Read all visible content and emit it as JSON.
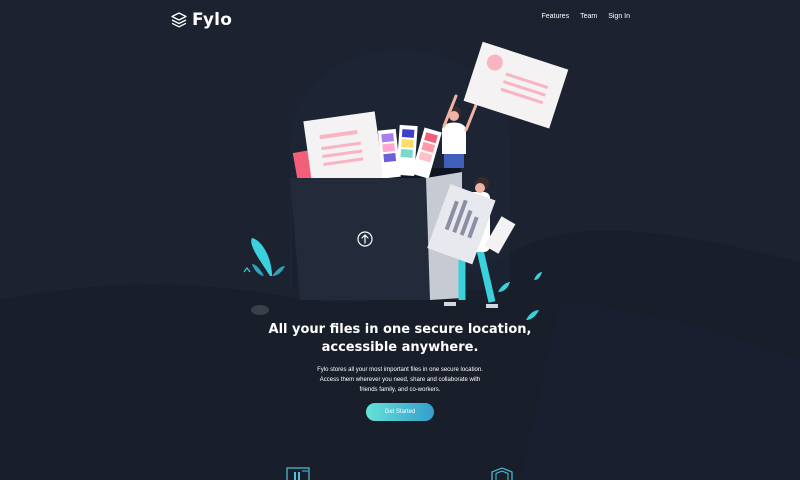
{
  "header": {
    "logo_text": "Fylo",
    "nav": [
      {
        "label": "Features"
      },
      {
        "label": "Team"
      },
      {
        "label": "Sign In"
      }
    ]
  },
  "hero": {
    "title_line1": "All your files in one secure location,",
    "title_line2": "accessible anywhere.",
    "description": "Fylo stores all your most important files in one secure location. Access them wherever you need, share and collaborate with friends family, and co-workers.",
    "cta_label": "Get Started"
  },
  "colors": {
    "background": "#1c2230",
    "curve": "#181e2a",
    "accent_start": "#65e2d9",
    "accent_end": "#339ecc"
  },
  "icons": [
    "layers-logo-icon",
    "upload-arrow-icon",
    "access-anywhere-icon",
    "security-shield-icon"
  ]
}
